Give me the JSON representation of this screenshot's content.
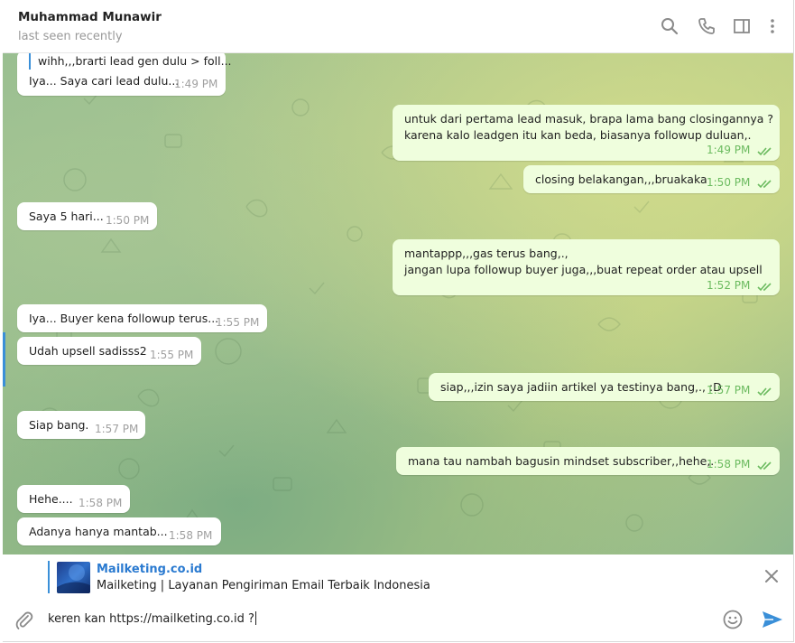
{
  "header": {
    "name": "Muhammad Munawir",
    "status": "last seen recently"
  },
  "messages": [
    {
      "dir": "in",
      "quote": "wihh,,,brarti lead gen dulu > foll...",
      "lines": [
        "Iya... Saya cari lead dulu..."
      ],
      "time": "1:49 PM"
    },
    {
      "dir": "out",
      "lines": [
        "untuk dari pertama lead masuk, brapa lama bang closingannya ?",
        "karena kalo leadgen itu kan beda, biasanya followup duluan,."
      ],
      "time": "1:49 PM"
    },
    {
      "dir": "out",
      "lines": [
        "closing belakangan,,,bruakaka"
      ],
      "time": "1:50 PM"
    },
    {
      "dir": "in",
      "lines": [
        "Saya 5 hari..."
      ],
      "time": "1:50 PM"
    },
    {
      "dir": "out",
      "lines": [
        "mantappp,,,gas terus bang,.,",
        "jangan lupa followup buyer juga,,,buat repeat order atau upsell"
      ],
      "time": "1:52 PM"
    },
    {
      "dir": "in",
      "lines": [
        "Iya... Buyer kena followup terus..."
      ],
      "time": "1:55 PM"
    },
    {
      "dir": "in",
      "lines": [
        "Udah upsell sadisss2"
      ],
      "time": "1:55 PM"
    },
    {
      "dir": "out",
      "lines": [
        "siap,,,izin saya jadiin artikel ya testinya bang,., :D"
      ],
      "time": "1:57 PM"
    },
    {
      "dir": "in",
      "lines": [
        "Siap bang."
      ],
      "time": "1:57 PM"
    },
    {
      "dir": "out",
      "lines": [
        "mana tau nambah bagusin mindset subscriber,,hehe,."
      ],
      "time": "1:58 PM"
    },
    {
      "dir": "in",
      "lines": [
        "Hehe...."
      ],
      "time": "1:58 PM"
    },
    {
      "dir": "in",
      "lines": [
        "Adanya hanya mantab..."
      ],
      "time": "1:58 PM"
    }
  ],
  "link_preview": {
    "title": "Mailketing.co.id",
    "description": "Mailketing | Layanan Pengiriman Email Terbaik Indonesia"
  },
  "composer": {
    "value": "keren kan https://mailketing.co.id ?"
  },
  "icons": {
    "search": "search-icon",
    "call": "phone-icon",
    "sidebar": "sidebar-toggle-icon",
    "menu": "more-vertical-icon",
    "attach": "paperclip-icon",
    "emoji": "emoji-icon",
    "send": "send-icon",
    "close": "close-icon"
  },
  "colors": {
    "accent": "#3a8fd8",
    "outgoing_bubble": "#effedd",
    "incoming_bubble": "#ffffff",
    "read_check": "#6cbb60"
  }
}
